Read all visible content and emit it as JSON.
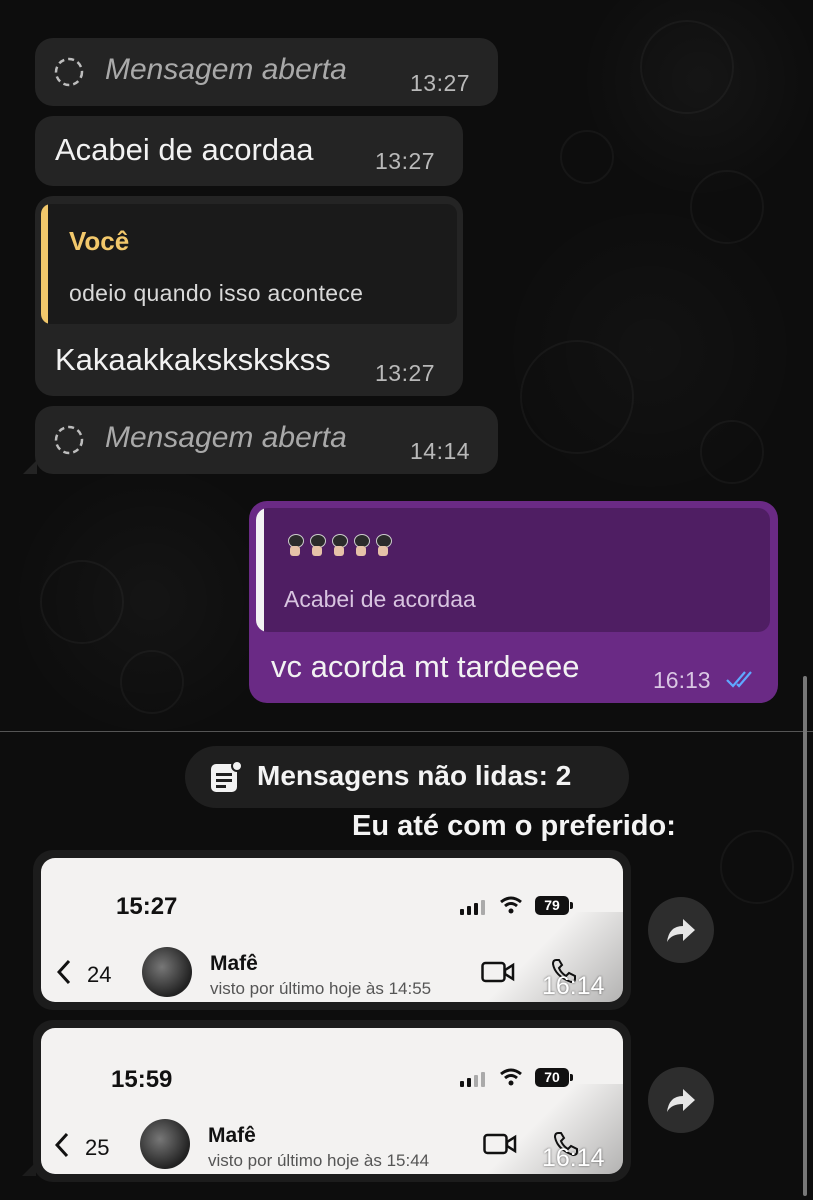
{
  "chat": {
    "msg1": {
      "text": "Mensagem aberta",
      "time": "13:27",
      "icon": "view-once-icon"
    },
    "msg2": {
      "text": "Acabei de acordaa",
      "time": "13:27"
    },
    "msg3": {
      "reply_sender": "Você",
      "reply_text": "odeio quando isso acontece",
      "text": "Kakaakkakskskskss",
      "time": "13:27"
    },
    "msg4": {
      "text": "Mensagem aberta",
      "time": "14:14",
      "icon": "view-once-icon"
    },
    "sent": {
      "reply_emojis": "🧛‍♀️🧛‍♀️🧛‍♀️🧛‍♀️🧛‍♀️",
      "reply_text": "Acabei de acordaa",
      "text": "vc acorda mt tardeeee",
      "time": "16:13",
      "status_icon": "double-check-icon"
    }
  },
  "unread": {
    "label": "Mensagens não lidas: 2",
    "icon": "unread-list-icon"
  },
  "caption": "Eu até com o preferido:",
  "screenshots": [
    {
      "clock": "15:27",
      "battery": "79",
      "back_count": "24",
      "contact": "Mafê",
      "last_seen": "visto por último hoje às 14:55",
      "time": "16:14"
    },
    {
      "clock": "15:59",
      "battery": "70",
      "back_count": "25",
      "contact": "Mafê",
      "last_seen": "visto por último hoje às 15:44",
      "time": "16:14"
    }
  ],
  "colors": {
    "incoming": "#242424",
    "outgoing": "#6a2a85",
    "reply_accent": "#f2c86b",
    "read_check": "#5fa8ff"
  }
}
